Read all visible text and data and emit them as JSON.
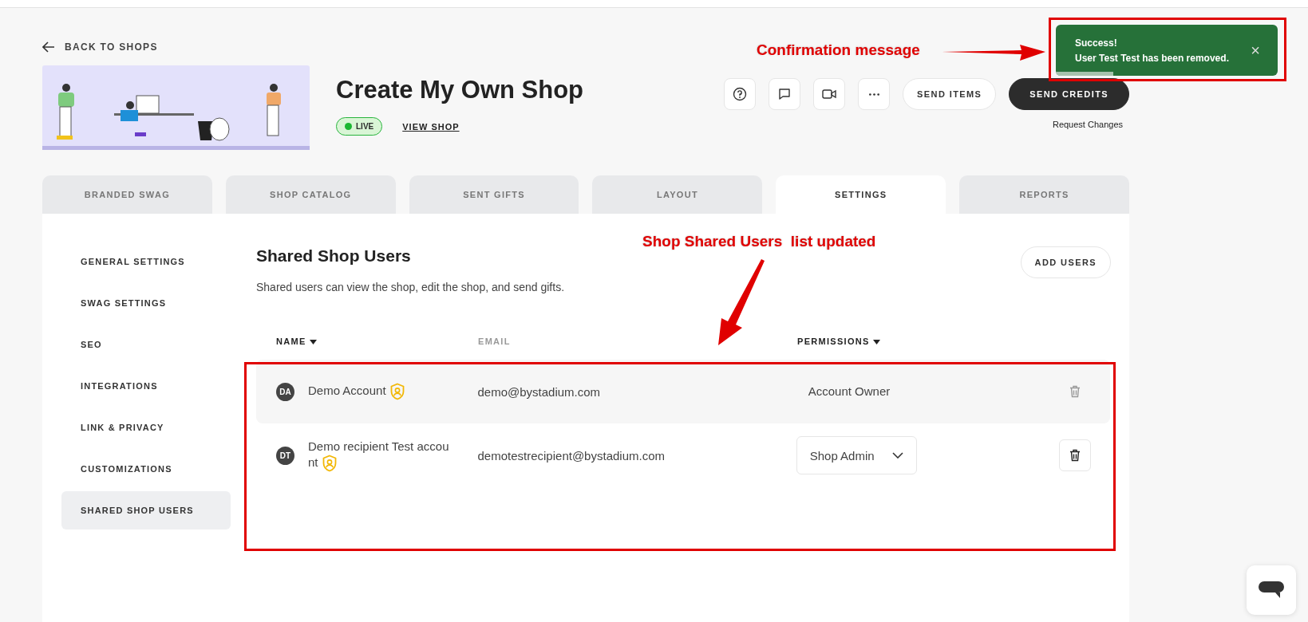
{
  "back_link": "BACK TO SHOPS",
  "shop": {
    "title": "Create My Own Shop",
    "status": "LIVE",
    "view_link": "VIEW SHOP"
  },
  "actions": {
    "send_items": "SEND ITEMS",
    "send_credits": "SEND CREDITS",
    "request_changes": "Request Changes"
  },
  "toast": {
    "title": "Success!",
    "message": "User Test Test has been removed.",
    "close": "×"
  },
  "tabs": [
    {
      "label": "BRANDED SWAG",
      "selected": false
    },
    {
      "label": "SHOP CATALOG",
      "selected": false
    },
    {
      "label": "SENT GIFTS",
      "selected": false
    },
    {
      "label": "LAYOUT",
      "selected": false
    },
    {
      "label": "SETTINGS",
      "selected": true
    },
    {
      "label": "REPORTS",
      "selected": false
    }
  ],
  "sidebar": {
    "items": [
      {
        "label": "GENERAL SETTINGS",
        "selected": false
      },
      {
        "label": "SWAG SETTINGS",
        "selected": false
      },
      {
        "label": "SEO",
        "selected": false
      },
      {
        "label": "INTEGRATIONS",
        "selected": false
      },
      {
        "label": "LINK & PRIVACY",
        "selected": false
      },
      {
        "label": "CUSTOMIZATIONS",
        "selected": false
      },
      {
        "label": "SHARED SHOP USERS",
        "selected": true
      }
    ]
  },
  "section": {
    "title": "Shared Shop Users",
    "description": "Shared users can view the shop, edit the shop, and send gifts.",
    "add_button": "ADD USERS"
  },
  "table": {
    "columns": [
      "NAME",
      "EMAIL",
      "PERMISSIONS"
    ],
    "rows": [
      {
        "initials": "DA",
        "name": "Demo Account",
        "email": "demo@bystadium.com",
        "permission": "Account Owner",
        "kind": "text"
      },
      {
        "initials": "DT",
        "name": "Demo recipient Test account",
        "email": "demotestrecipient@bystadium.com",
        "permission": "Shop Admin",
        "kind": "dropdown"
      }
    ]
  },
  "annotations": [
    {
      "text": "Confirmation message"
    },
    {
      "text": "Shop Shared Users  list updated"
    }
  ]
}
